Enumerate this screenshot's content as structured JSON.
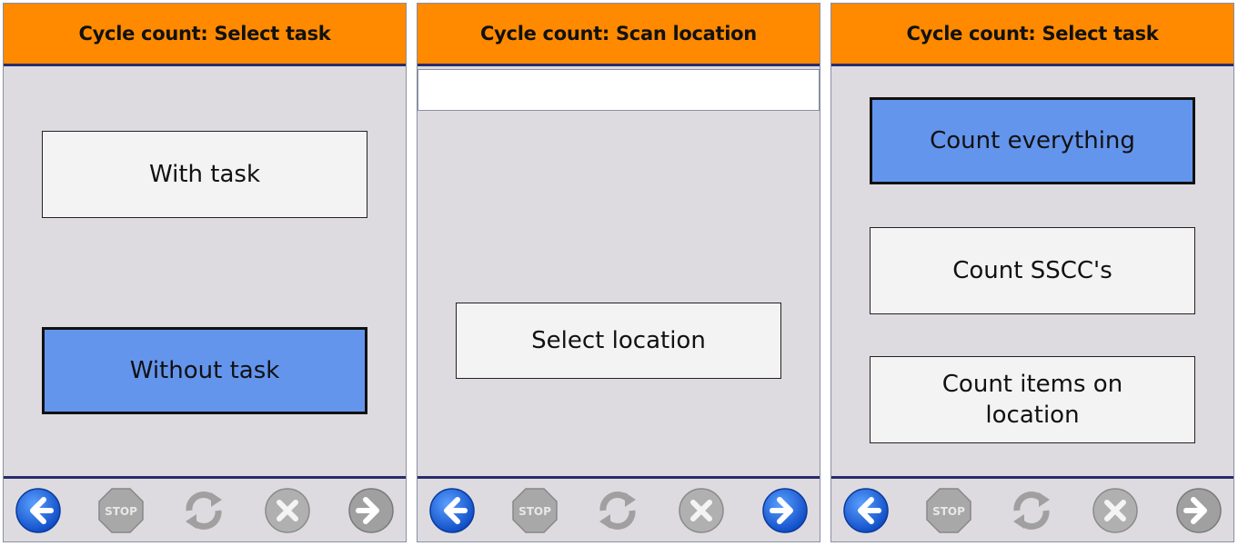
{
  "colors": {
    "header": "#ff8a00",
    "panel_bg": "#dedbe0",
    "button_bg": "#f3f3f3",
    "button_active": "#6495ed",
    "nav_blue": "#1a5fd6",
    "nav_gray": "#9a9a9a"
  },
  "panels": [
    {
      "title": "Cycle count: Select task",
      "buttons": [
        {
          "label": "With task",
          "active": false
        },
        {
          "label": "Without task",
          "active": true
        }
      ]
    },
    {
      "title": "Cycle count: Scan location",
      "scan_field_value": "",
      "buttons": [
        {
          "label": "Select location",
          "active": false
        }
      ]
    },
    {
      "title": "Cycle count: Select task",
      "buttons": [
        {
          "label": "Count everything",
          "active": true
        },
        {
          "label": "Count SSCC's",
          "active": false
        },
        {
          "label": "Count items on location",
          "active": false
        }
      ]
    }
  ],
  "nav": {
    "back_icon": "back-arrow-icon",
    "stop_icon": "stop-icon",
    "stop_label": "STOP",
    "refresh_icon": "refresh-icon",
    "cancel_icon": "cancel-x-icon",
    "next_icon": "forward-arrow-icon"
  }
}
